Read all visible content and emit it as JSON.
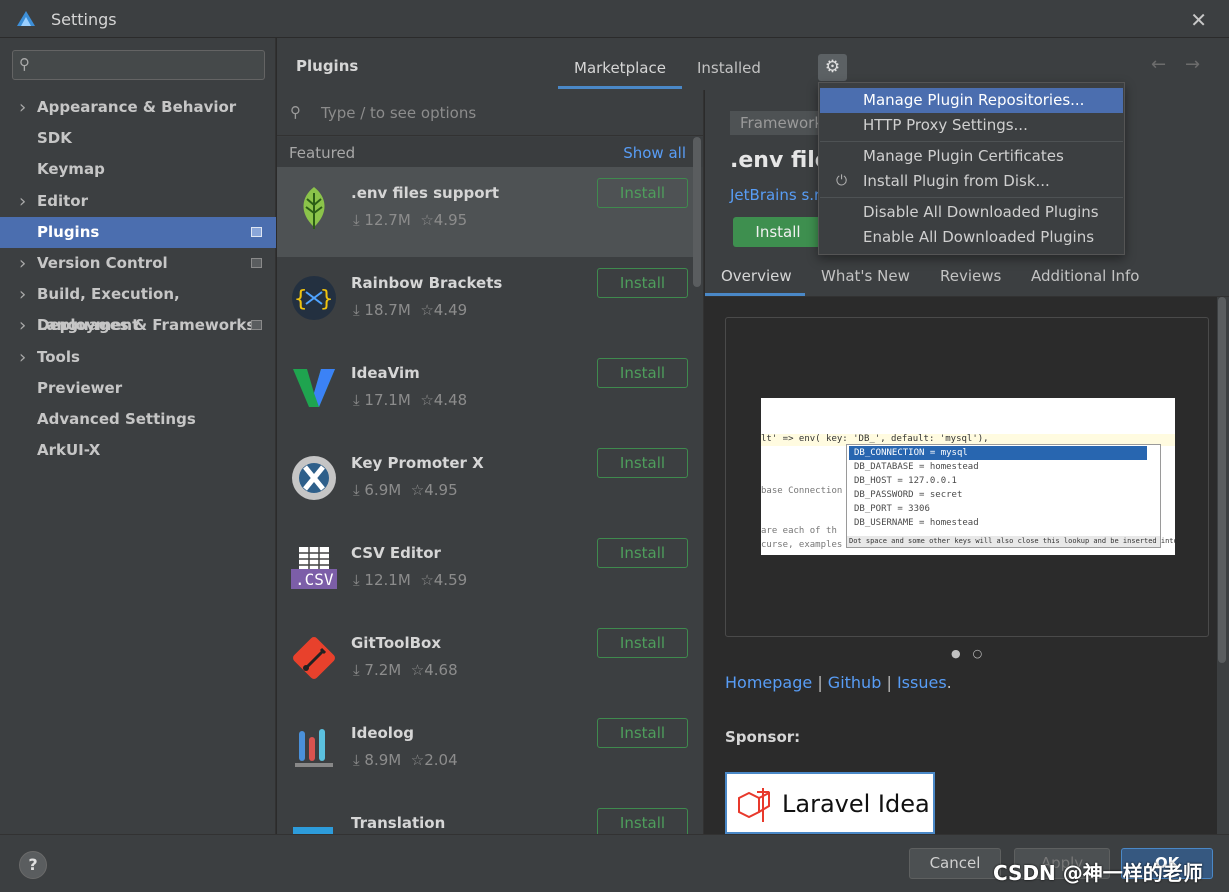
{
  "window": {
    "title": "Settings",
    "close_glyph": "✕"
  },
  "sidebar": {
    "search_placeholder": "",
    "items": [
      {
        "label": "Appearance & Behavior",
        "expandable": true
      },
      {
        "label": "SDK",
        "expandable": false
      },
      {
        "label": "Keymap",
        "expandable": false
      },
      {
        "label": "Editor",
        "expandable": true
      },
      {
        "label": "Plugins",
        "expandable": false,
        "active": true
      },
      {
        "label": "Version Control",
        "expandable": true
      },
      {
        "label": "Build, Execution, Deployment",
        "expandable": true
      },
      {
        "label": "Languages & Frameworks",
        "expandable": true
      },
      {
        "label": "Tools",
        "expandable": true
      },
      {
        "label": "Previewer",
        "expandable": false
      },
      {
        "label": "Advanced Settings",
        "expandable": false
      },
      {
        "label": "ArkUI-X",
        "expandable": false
      }
    ]
  },
  "plugins_header": {
    "title": "Plugins",
    "tabs": [
      {
        "label": "Marketplace",
        "active": true
      },
      {
        "label": "Installed"
      }
    ],
    "gear_icon": "gear-icon",
    "back_glyph": "←",
    "forward_glyph": "→"
  },
  "plugin_list": {
    "search_placeholder": "Type / to see options",
    "section_label": "Featured",
    "show_all": "Show all",
    "install_label": "Install",
    "items": [
      {
        "name": ".env files support",
        "downloads": "12.7M",
        "rating": "4.95"
      },
      {
        "name": "Rainbow Brackets",
        "downloads": "18.7M",
        "rating": "4.49"
      },
      {
        "name": "IdeaVim",
        "downloads": "17.1M",
        "rating": "4.48"
      },
      {
        "name": "Key Promoter X",
        "downloads": "6.9M",
        "rating": "4.95"
      },
      {
        "name": "CSV Editor",
        "downloads": "12.1M",
        "rating": "4.59"
      },
      {
        "name": "GitToolBox",
        "downloads": "7.2M",
        "rating": "4.68"
      },
      {
        "name": "Ideolog",
        "downloads": "8.9M",
        "rating": "2.04"
      },
      {
        "name": "Translation",
        "downloads": "",
        "rating": ""
      }
    ]
  },
  "detail": {
    "tag": "Framework",
    "title": ".env file",
    "vendor": "JetBrains s.r.",
    "install_label": "Install",
    "tabs": [
      "Overview",
      "What's New",
      "Reviews",
      "Additional Info"
    ],
    "screenshot": {
      "code_line": "lt' => env( key: 'DB_', default: 'mysql'),",
      "gray_lines": [
        "base Connection",
        "are each of th",
        "curse, examples of"
      ],
      "popup_items": [
        "DB_CONNECTION = mysql",
        "DB_DATABASE = homestead",
        "DB_HOST = 127.0.0.1",
        "DB_PASSWORD = secret",
        "DB_PORT = 3306",
        "DB_USERNAME = homestead"
      ],
      "popup_footer": "Dot space and some other keys will also close this lookup and be inserted into editor"
    },
    "links": {
      "homepage": "Homepage",
      "github": "Github",
      "issues": "Issues",
      "sep": "|",
      "end": "."
    },
    "sponsor_label": "Sponsor:",
    "sponsor_text": "Laravel Idea"
  },
  "gear_menu": {
    "items": [
      {
        "label": "Manage Plugin Repositories...",
        "highlighted": true
      },
      {
        "label": "HTTP Proxy Settings..."
      },
      {
        "label": "Manage Plugin Certificates"
      },
      {
        "label": "Install Plugin from Disk...",
        "icon": "plug-icon"
      },
      {
        "label": "Disable All Downloaded Plugins"
      },
      {
        "label": "Enable All Downloaded Plugins"
      }
    ]
  },
  "footer": {
    "help": "?",
    "cancel": "Cancel",
    "apply": "Apply",
    "ok": "OK",
    "watermark": "CSDN @神一样的老师"
  },
  "colors": {
    "accent_blue": "#4b6eaf",
    "link_blue": "#589df6",
    "install_green": "#3e8f4f",
    "bg_dark": "#2b2b2b",
    "panel": "#3c3f41"
  }
}
